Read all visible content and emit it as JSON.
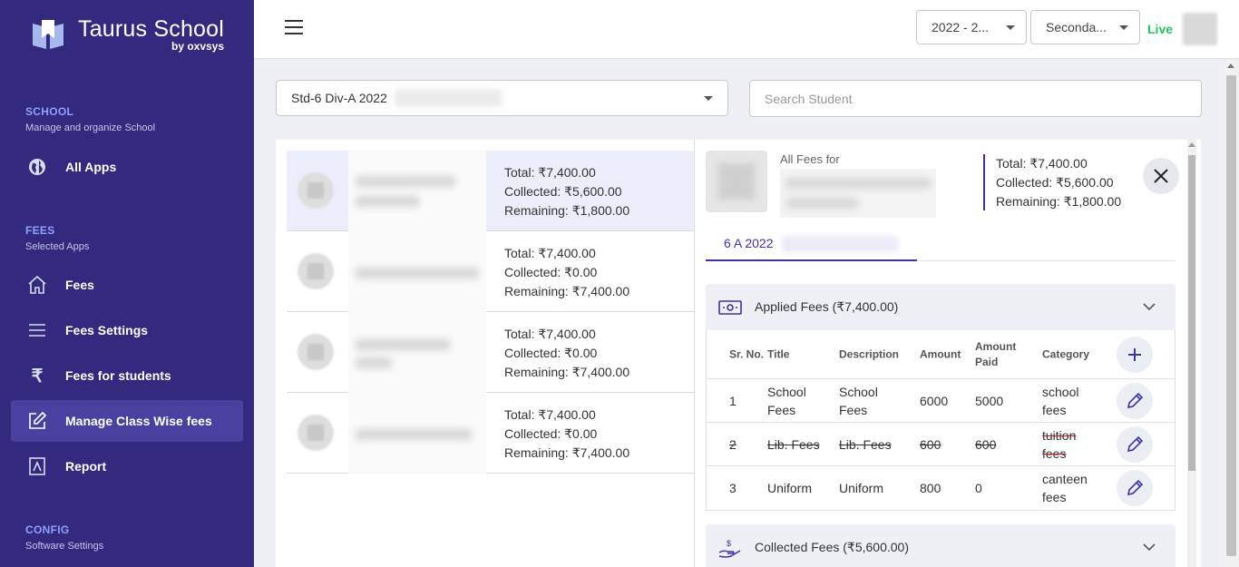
{
  "brand": {
    "title": "Taurus School",
    "subtitle": "by oxvsys"
  },
  "sidebar": {
    "sections": [
      {
        "title": "SCHOOL",
        "subtitle": "Manage and organize School"
      },
      {
        "title": "FEES",
        "subtitle": "Selected Apps"
      },
      {
        "title": "CONFIG",
        "subtitle": "Software Settings"
      }
    ],
    "items": [
      {
        "label": "All Apps",
        "icon": "globe-icon"
      },
      {
        "label": "Fees",
        "icon": "home-icon"
      },
      {
        "label": "Fees Settings",
        "icon": "menu-lines-icon"
      },
      {
        "label": "Fees for students",
        "icon": "rupee-icon"
      },
      {
        "label": "Manage Class Wise fees",
        "icon": "edit-icon",
        "active": true
      },
      {
        "label": "Report",
        "icon": "report-icon"
      }
    ]
  },
  "topbar": {
    "year_select": "2022 - 2...",
    "level_select": "Seconda...",
    "status": "Live"
  },
  "filters": {
    "class_select": "Std-6 Div-A 2022",
    "search_placeholder": "Search Student"
  },
  "students": [
    {
      "total": "Total: ₹7,400.00",
      "collected": "Collected: ₹5,600.00",
      "remaining": "Remaining: ₹1,800.00"
    },
    {
      "total": "Total: ₹7,400.00",
      "collected": "Collected: ₹0.00",
      "remaining": "Remaining: ₹7,400.00"
    },
    {
      "total": "Total: ₹7,400.00",
      "collected": "Collected: ₹0.00",
      "remaining": "Remaining: ₹7,400.00"
    },
    {
      "total": "Total: ₹7,400.00",
      "collected": "Collected: ₹0.00",
      "remaining": "Remaining: ₹7,400.00"
    }
  ],
  "detail": {
    "header_label": "All Fees for",
    "total": "Total: ₹7,400.00",
    "collected": "Collected: ₹5,600.00",
    "remaining": "Remaining: ₹1,800.00",
    "tab": "6 A 2022",
    "applied_title": "Applied Fees (₹7,400.00)",
    "collected_title": "Collected Fees (₹5,600.00)",
    "columns": {
      "srno": "Sr. No.",
      "title": "Title",
      "description": "Description",
      "amount": "Amount",
      "paid": "Amount Paid",
      "category": "Category"
    },
    "rows": [
      {
        "sr": "1",
        "title": "School Fees",
        "description": "School Fees",
        "amount": "6000",
        "paid": "5000",
        "category": "school fees",
        "struck": false
      },
      {
        "sr": "2",
        "title": "Lib. Fees",
        "description": "Lib. Fees",
        "amount": "600",
        "paid": "600",
        "category": "tuition fees",
        "struck": true
      },
      {
        "sr": "3",
        "title": "Uniform",
        "description": "Uniform",
        "amount": "800",
        "paid": "0",
        "category": "canteen fees",
        "struck": false
      }
    ]
  },
  "colors": {
    "sidebar": "#33297e",
    "accent": "#3d33a3",
    "live": "#22c55e",
    "danger": "#b91c1c"
  }
}
